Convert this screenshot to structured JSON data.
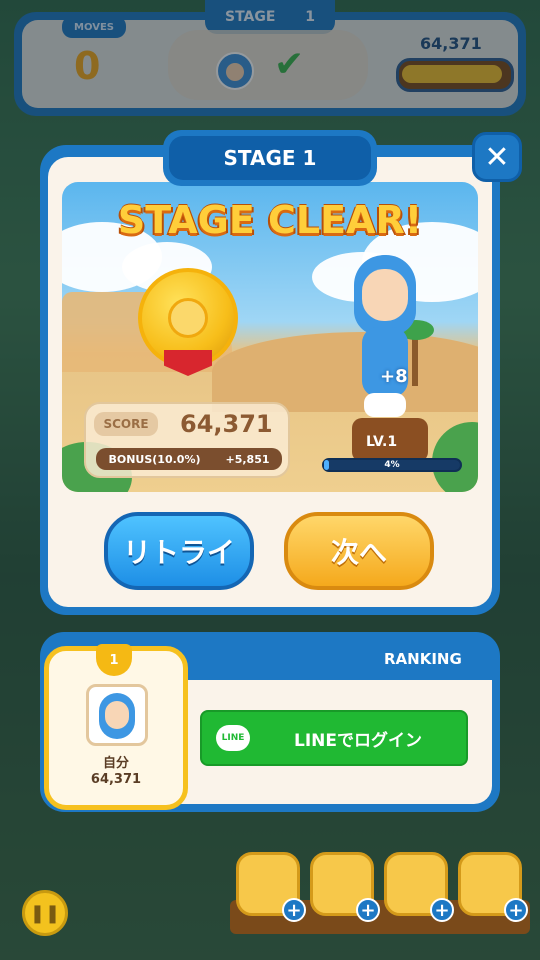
{
  "hud": {
    "stage_label": "STAGE",
    "stage_number": "1",
    "moves_label": "MOVES",
    "moves_value": "0",
    "score": "64,371",
    "goal_icon": "character-face-icon",
    "goal_status_icon": "checkmark-icon"
  },
  "dialog": {
    "stage_title": "STAGE 1",
    "headline": "STAGE CLEAR!",
    "score_label": "SCORE",
    "score_value": "64,371",
    "bonus_label": "BONUS(10.0%)",
    "bonus_value": "+5,851",
    "exp_gain": "+8",
    "level": "LV.1",
    "exp_percent_text": "4%",
    "exp_fraction": 0.04,
    "close_icon": "close-icon",
    "retry_label": "リトライ",
    "next_label": "次へ"
  },
  "ranking": {
    "title": "RANKING",
    "rank": "1",
    "player_name": "自分",
    "player_score": "64,371",
    "line_icon_text": "LINE",
    "line_login_label": "LINEでログイン"
  },
  "bottom": {
    "pause_icon": "pause-icon",
    "boosters": [
      {
        "icon": "bomb-booster-icon",
        "add": "+"
      },
      {
        "icon": "hand-booster-icon",
        "add": "+"
      },
      {
        "icon": "swap-booster-icon",
        "add": "+"
      },
      {
        "icon": "shoe-booster-icon",
        "add": "+"
      }
    ]
  },
  "colors": {
    "frame_blue": "#1d78c4",
    "gold": "#f5b20c",
    "line_green": "#20b933",
    "retry_blue": "#1e8fe6",
    "next_orange": "#f5a91c"
  }
}
